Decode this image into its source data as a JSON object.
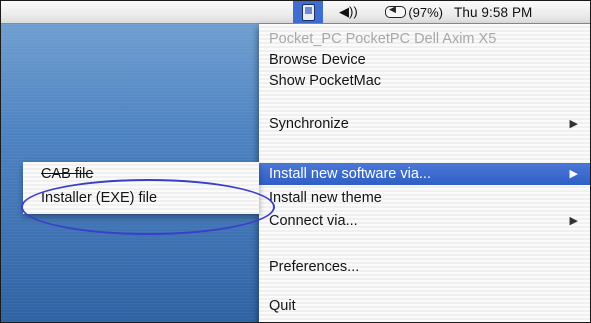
{
  "menubar": {
    "icons": [
      "pocketmac-device-icon",
      "speaker-icon",
      "battery-icon"
    ],
    "speaker_glyph": "◀))",
    "battery_text": "(97%)",
    "clock": "Thu 9:58 PM"
  },
  "menu": {
    "device_title": "Pocket_PC PocketPC Dell Axim X5",
    "items": [
      {
        "label": "Browse Device"
      },
      {
        "label": "Show PocketMac"
      },
      {
        "label": "Synchronize"
      },
      {
        "label": "Install new software via..."
      },
      {
        "label": "Install new theme"
      },
      {
        "label": "Connect via..."
      },
      {
        "label": "Preferences..."
      },
      {
        "label": "Quit"
      }
    ],
    "highlight_color": "#3868cc"
  },
  "submenu": {
    "items": [
      {
        "label": "CAB file"
      },
      {
        "label": "Installer (EXE) file"
      }
    ]
  },
  "annotation_color": "#3b3ec9"
}
